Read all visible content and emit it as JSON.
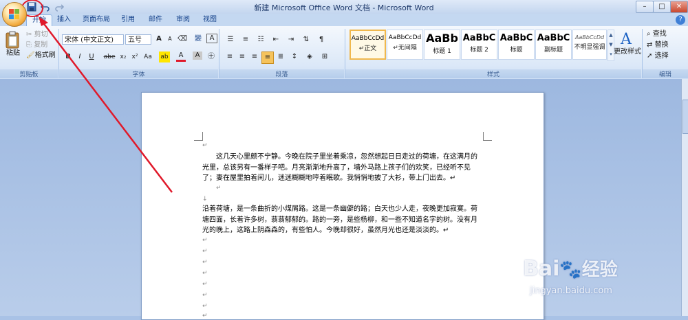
{
  "window": {
    "title": "新建 Microsoft Office Word 文档 - Microsoft Word",
    "minimize": "–",
    "maximize": "□",
    "close": "✕"
  },
  "tabs": [
    "开始",
    "插入",
    "页面布局",
    "引用",
    "邮件",
    "审阅",
    "视图"
  ],
  "clipboard": {
    "paste": "粘贴",
    "cut": "剪切",
    "copy": "复制",
    "format_painter": "格式刷",
    "group": "剪贴板"
  },
  "font": {
    "name": "宋体 (中文正文)",
    "size": "五号",
    "grow": "A",
    "shrink": "A",
    "bold": "B",
    "italic": "I",
    "underline": "U",
    "strike": "abe",
    "subscript": "x₂",
    "superscript": "x²",
    "change_case": "Aa",
    "highlight": "ab",
    "color": "A",
    "char_shading": "A",
    "group": "字体",
    "wen": "變",
    "char_border": "A"
  },
  "paragraph": {
    "group": "段落"
  },
  "styles": {
    "group": "样式",
    "items": [
      {
        "sample": "AaBbCcDd",
        "name": "↵正文"
      },
      {
        "sample": "AaBbCcDd",
        "name": "↵无间隔"
      },
      {
        "sample": "AaBb",
        "name": "标题 1"
      },
      {
        "sample": "AaBbC",
        "name": "标题 2"
      },
      {
        "sample": "AaBbC",
        "name": "标题"
      },
      {
        "sample": "AaBbC",
        "name": "副标题"
      },
      {
        "sample": "AaBbCcDd",
        "name": "不明显强调"
      }
    ],
    "change_styles": "更改样式"
  },
  "editing": {
    "find": "查找",
    "replace": "替换",
    "select": "选择",
    "group": "编辑"
  },
  "document": {
    "para1": "　　这几天心里颇不宁静。今晚在院子里坐着乘凉，忽然想起日日走过的荷塘，在这满月的光里，总该另有一番样子吧。月亮渐渐地升高了，墙外马路上孩子们的欢笑，已经听不见了；妻在屋里拍着闰儿，迷迷糊糊地哼着眠歌。我悄悄地披了大衫，带上门出去。↵",
    "para2": "沿着荷塘，是一条曲折的小煤屑路。这是一条幽僻的路；白天也少人走，夜晚更加寂寞。荷塘四面，长着许多树，蓊蓊郁郁的。路的一旁，是些杨柳，和一些不知道名字的树。没有月光的晚上，这路上阴森森的，有些怕人。今晚却很好，虽然月光也还是淡淡的。↵",
    "return_mark": "↵",
    "down_mark": "↓"
  },
  "watermark": {
    "brand": "Bai",
    "brand2": "经验",
    "url": "jingyan.baidu.com"
  },
  "colors": {
    "annotation": "#e0192a",
    "accent": "#15428b",
    "ribbon_bg": "#dde9f8"
  }
}
